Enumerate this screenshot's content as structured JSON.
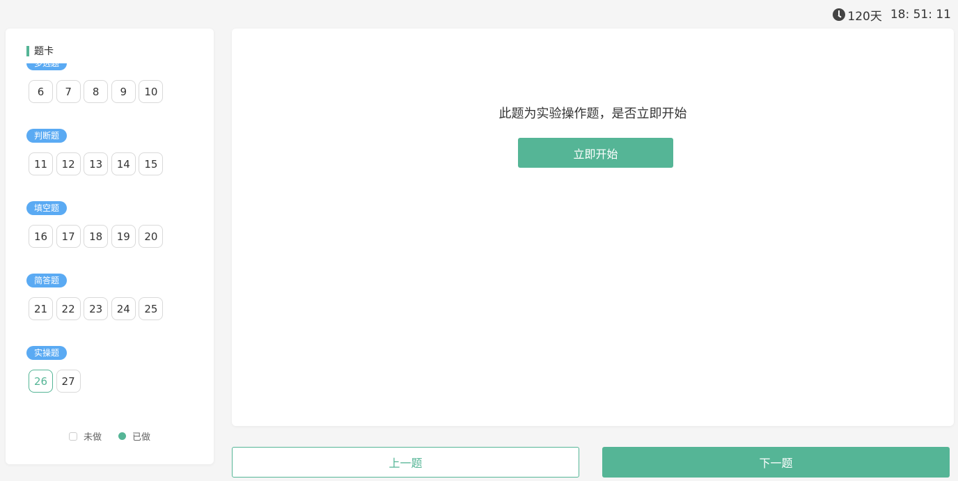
{
  "timer": {
    "icon": "clock-icon",
    "days": "120天",
    "time": "18: 51: 11"
  },
  "sidebar": {
    "title": "题卡",
    "sections": [
      {
        "tag": "多选题",
        "numbers": [
          "6",
          "7",
          "8",
          "9",
          "10"
        ]
      },
      {
        "tag": "判断题",
        "numbers": [
          "11",
          "12",
          "13",
          "14",
          "15"
        ]
      },
      {
        "tag": "填空题",
        "numbers": [
          "16",
          "17",
          "18",
          "19",
          "20"
        ]
      },
      {
        "tag": "简答题",
        "numbers": [
          "21",
          "22",
          "23",
          "24",
          "25"
        ]
      },
      {
        "tag": "实操题",
        "numbers": [
          "26",
          "27"
        ]
      }
    ],
    "current_question": "26",
    "legend": {
      "undone": "未做",
      "done": "已做"
    }
  },
  "main": {
    "prompt": "此题为实验操作题，是否立即开始",
    "start_button": "立即开始"
  },
  "footer": {
    "prev_label": "上一题",
    "next_label": "下一题"
  },
  "colors": {
    "accent": "#55b596",
    "tag": "#5aaaf3"
  }
}
